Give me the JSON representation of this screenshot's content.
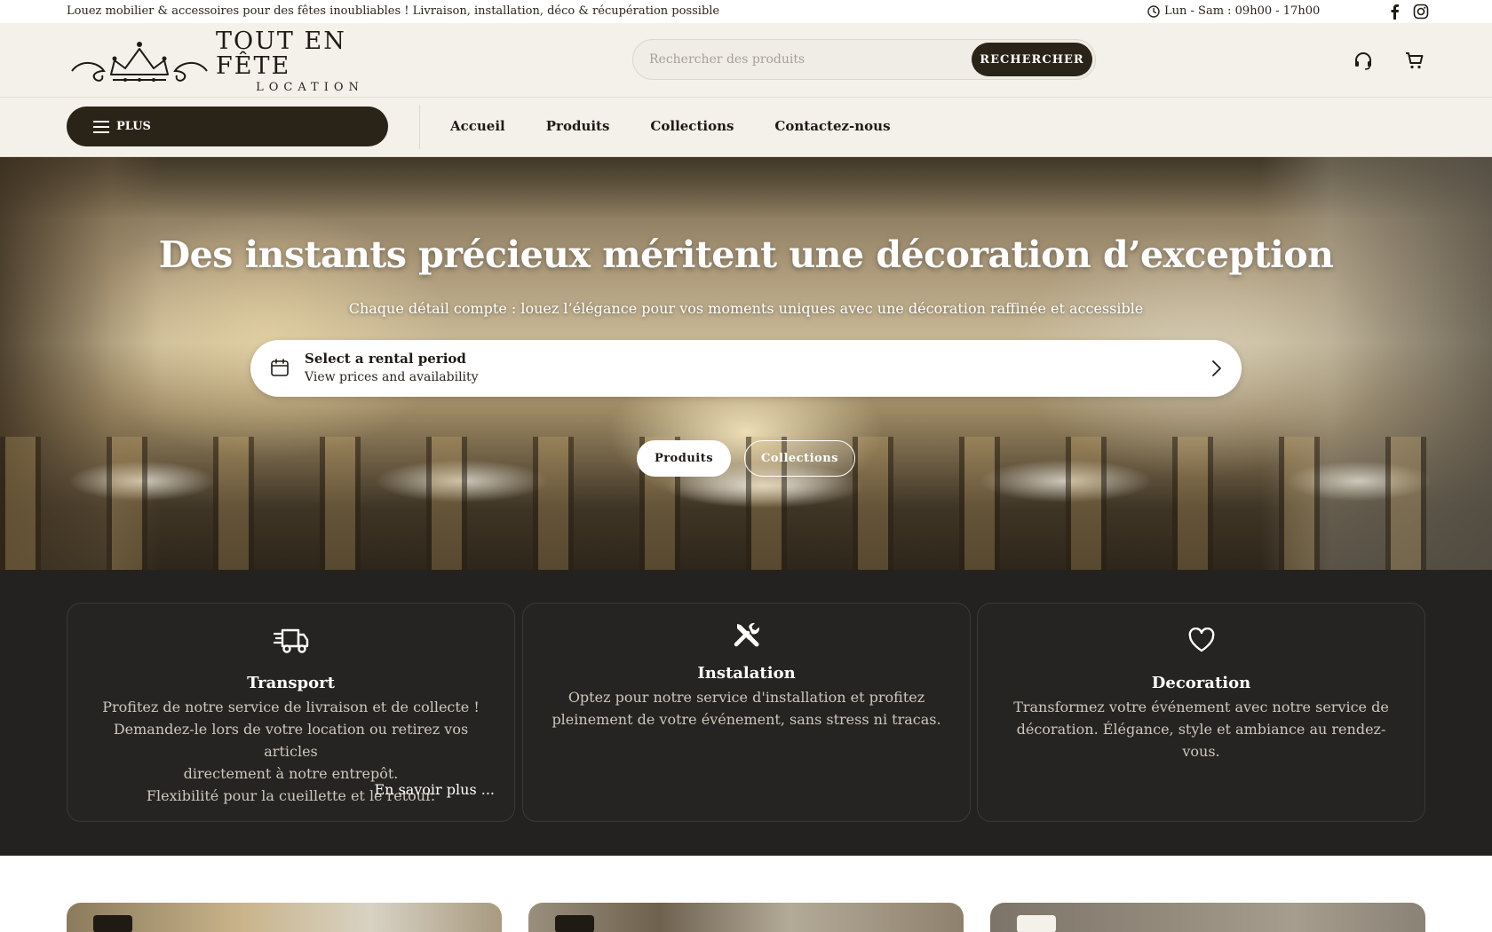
{
  "announcement": {
    "message": "Louez mobilier & accessoires pour des fêtes inoubliables ! Livraison, installation, déco & récupération possible",
    "hours": "Lun - Sam : 09h00 - 17h00"
  },
  "social": {
    "facebook_icon": "facebook-icon",
    "instagram_icon": "instagram-icon"
  },
  "brand": {
    "name": "TOUT EN FÊTE",
    "subname": "LOCATION"
  },
  "search": {
    "placeholder": "Rechercher des produits",
    "value": "",
    "button_label": "RECHERCHER"
  },
  "header_icons": {
    "support": "headset-icon",
    "cart": "cart-icon"
  },
  "nav": {
    "menu_label": "PLUS",
    "links": [
      "Accueil",
      "Produits",
      "Collections",
      "Contactez-nous"
    ]
  },
  "hero": {
    "title": "Des instants précieux méritent une décoration d’exception",
    "subtitle": "Chaque détail compte : louez l’élégance pour vos moments uniques avec une décoration raffinée et accessible",
    "rental_title": "Select a rental period",
    "rental_subtitle": "View prices and availability",
    "buttons": [
      "Produits",
      "Collections"
    ]
  },
  "services": [
    {
      "title": "Transport",
      "icon": "truck-icon",
      "lines": [
        "Profitez de notre service de livraison et de collecte !",
        "Demandez-le lors de votre location ou retirez vos articles",
        "directement à notre entrepôt.",
        "Flexibilité pour la cueillette et le retour."
      ],
      "link": "En savoir plus ..."
    },
    {
      "title": "Instalation",
      "icon": "tools-icon",
      "lines": [
        "Optez pour notre service d'installation et profitez",
        "pleinement de votre événement, sans stress ni tracas."
      ]
    },
    {
      "title": "Decoration",
      "icon": "heart-icon",
      "lines": [
        "Transformez votre événement avec notre service de",
        "décoration. Élégance, style et ambiance au rendez-vous."
      ]
    }
  ],
  "colors": {
    "dark": "#2a2418",
    "header_bg": "#f3f1ea",
    "services_bg": "#242220"
  }
}
